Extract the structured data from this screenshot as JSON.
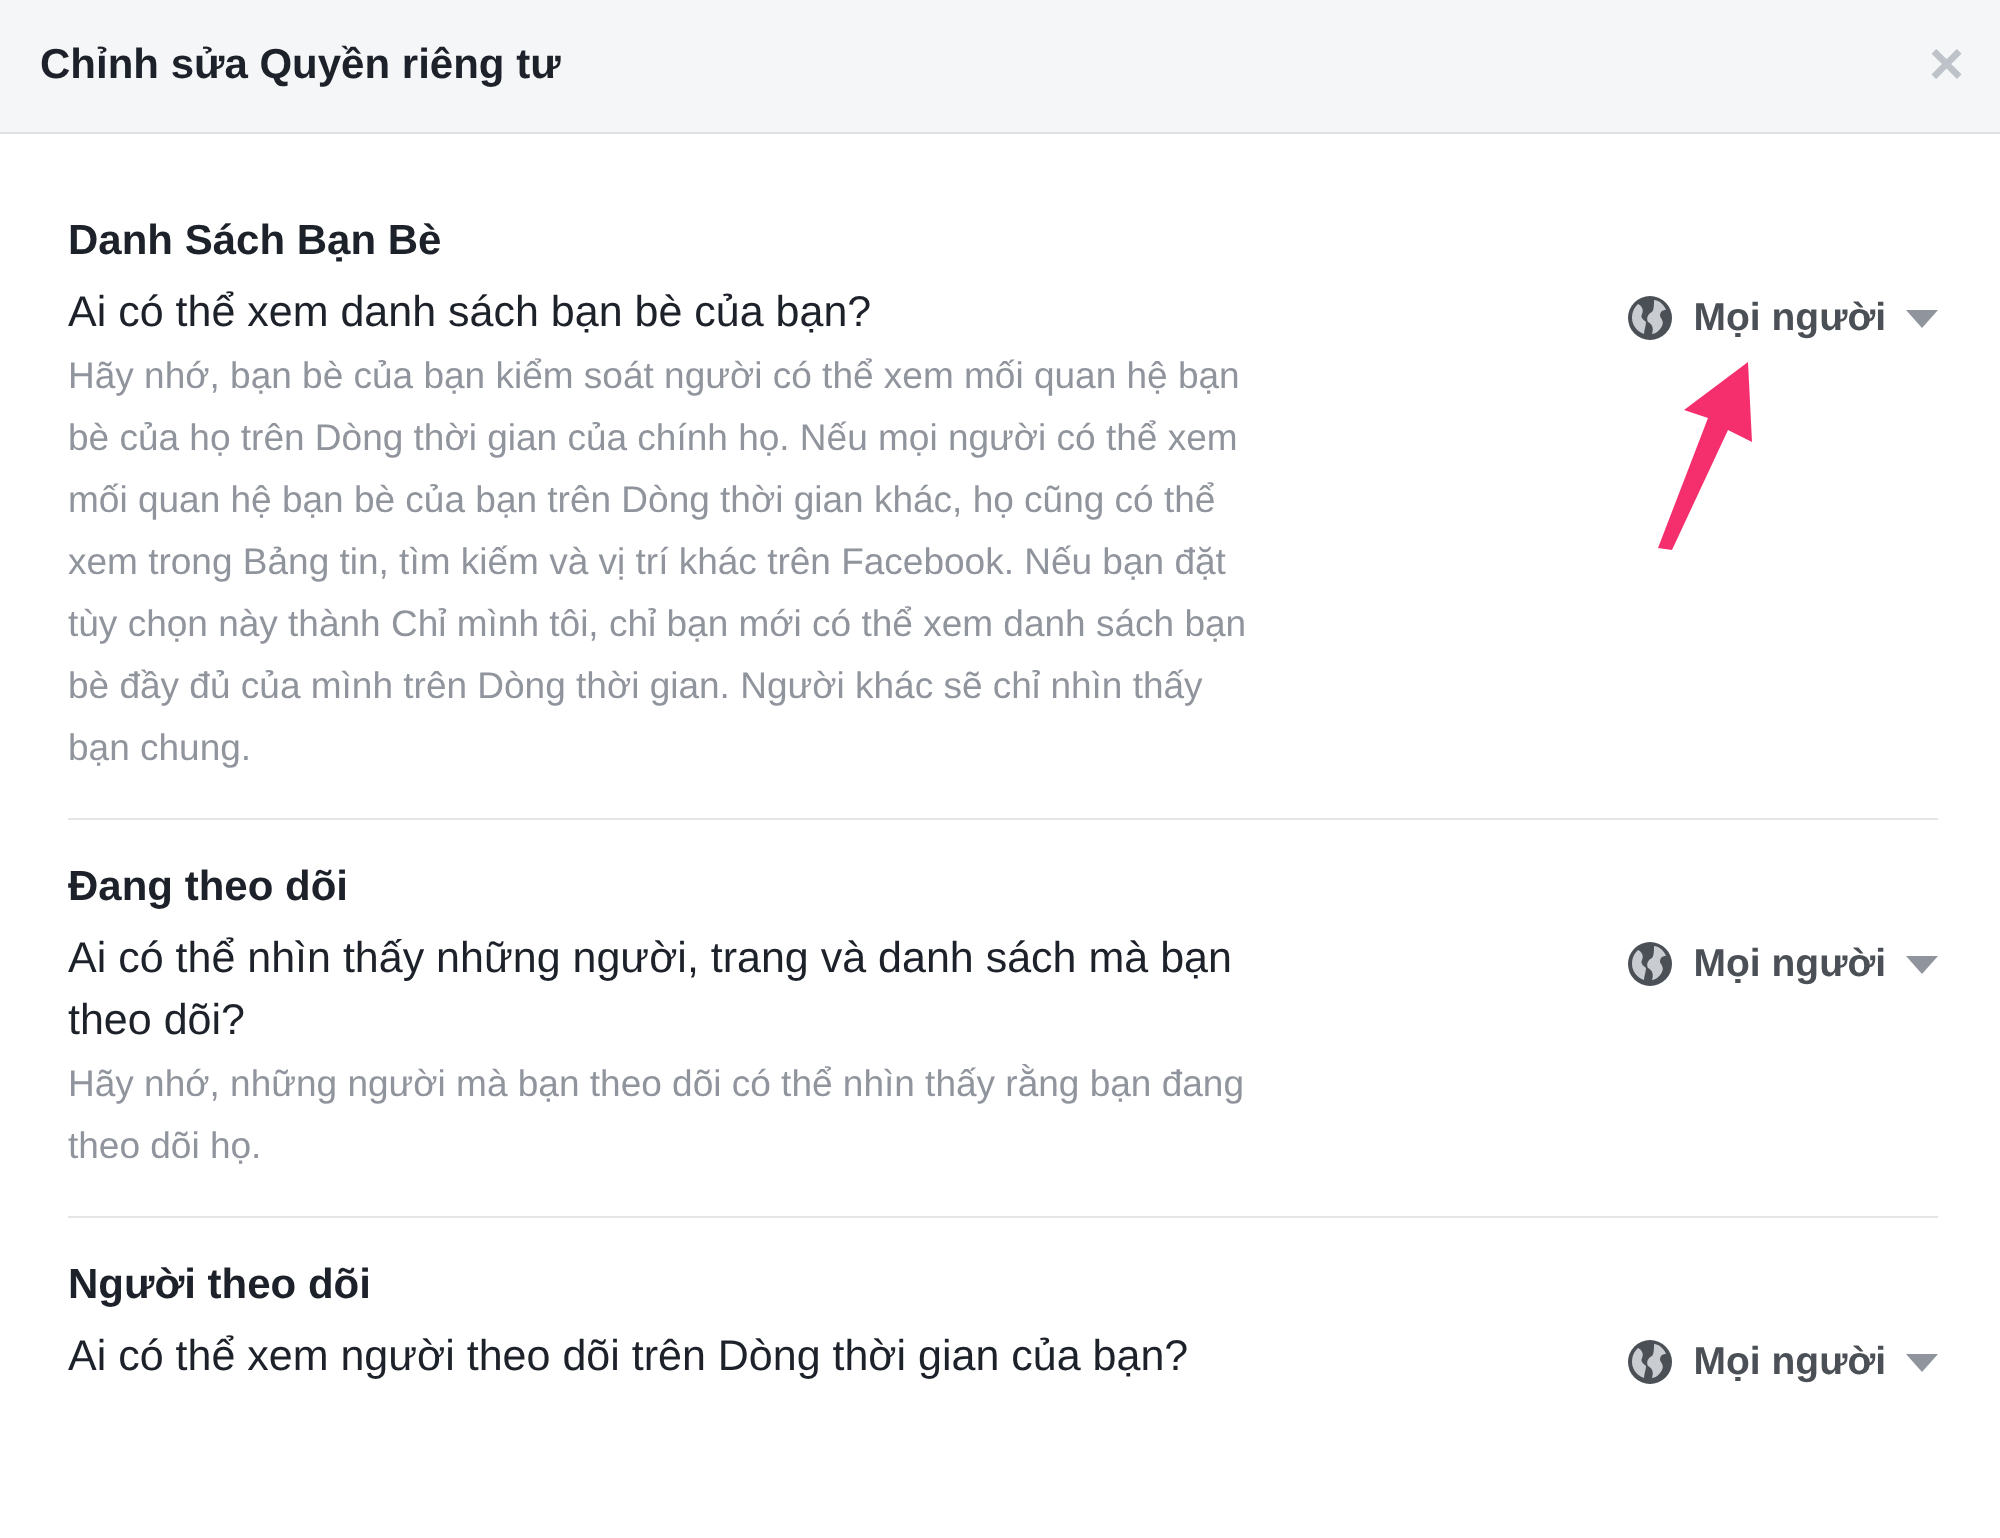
{
  "dialog": {
    "title": "Chỉnh sửa Quyền riêng tư",
    "close": "×"
  },
  "sections": [
    {
      "title": "Danh Sách Bạn Bè",
      "question": "Ai có thể xem danh sách bạn bè của bạn?",
      "description": "Hãy nhớ, bạn bè của bạn kiểm soát người có thể xem mối quan hệ bạn bè của họ trên Dòng thời gian của chính họ. Nếu mọi người có thể xem mối quan hệ bạn bè của bạn trên Dòng thời gian khác, họ cũng có thể xem trong Bảng tin, tìm kiếm và vị trí khác trên Facebook. Nếu bạn đặt tùy chọn này thành Chỉ mình tôi, chỉ bạn mới có thể xem danh sách bạn bè đầy đủ của mình trên Dòng thời gian. Người khác sẽ chỉ nhìn thấy bạn chung.",
      "audience": "Mọi người",
      "highlighted": true
    },
    {
      "title": "Đang theo dõi",
      "question": "Ai có thể nhìn thấy những người, trang và danh sách mà bạn theo dõi?",
      "description": "Hãy nhớ, những người mà bạn theo dõi có thể nhìn thấy rằng bạn đang theo dõi họ.",
      "audience": "Mọi người",
      "highlighted": false
    },
    {
      "title": "Người theo dõi",
      "question": "Ai có thể xem người theo dõi trên Dòng thời gian của bạn?",
      "audience": "Mọi người",
      "highlighted": false
    }
  ]
}
